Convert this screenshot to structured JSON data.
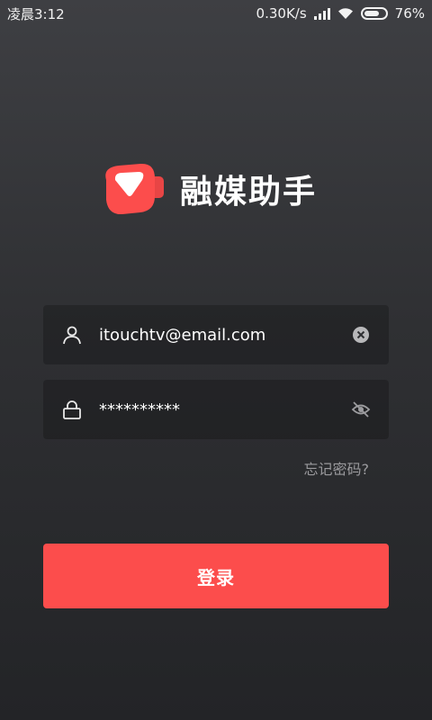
{
  "status_bar": {
    "time": "凌晨3:12",
    "network_speed": "0.30K/s",
    "battery_percent": "76%",
    "battery_level": 0.76
  },
  "app": {
    "name": "融媒助手",
    "brand_color": "#fc4d4c"
  },
  "login_form": {
    "email_value": "itouchtv@email.com",
    "password_value": "**********",
    "forgot_password_label": "忘记密码?",
    "login_label": "登录"
  },
  "icons": {
    "email_lead": "user-icon",
    "email_trail": "clear-icon",
    "password_lead": "lock-icon",
    "password_trail": "eye-off-icon"
  }
}
